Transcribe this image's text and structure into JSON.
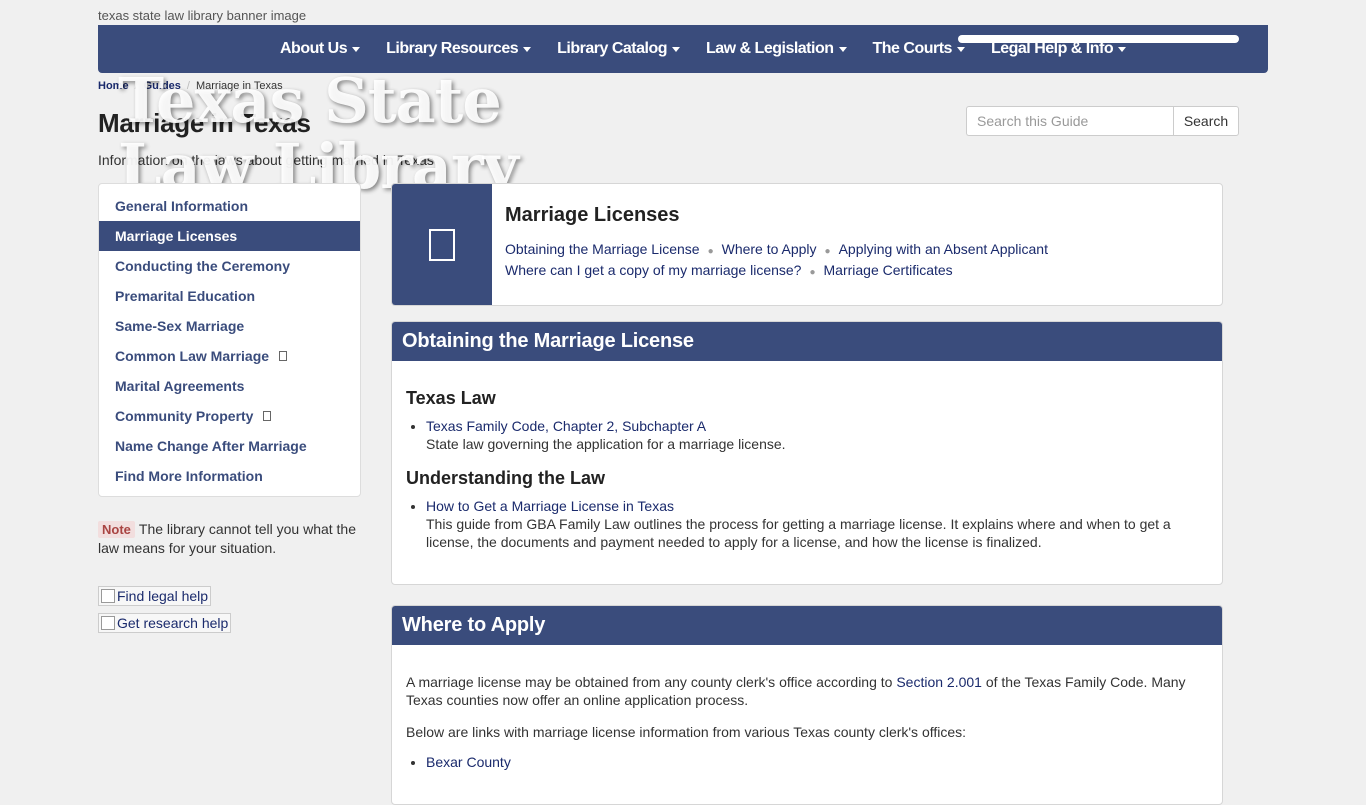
{
  "banner_alt": "texas state law library banner image",
  "logo_text_line1": "Texas State",
  "logo_text_line2": "Law Library",
  "nav": [
    "About Us",
    "Library Resources",
    "Library Catalog",
    "Law & Legislation",
    "The Courts",
    "Legal Help & Info"
  ],
  "breadcrumb": [
    "Home",
    "Guides",
    "Marriage in Texas"
  ],
  "page": {
    "title": "Marriage in Texas",
    "description": "Information on the laws about getting married in Texas"
  },
  "search": {
    "placeholder": "Search this Guide",
    "button": "Search"
  },
  "sidebar": [
    {
      "label": "General Information"
    },
    {
      "label": "Marriage Licenses",
      "active": true
    },
    {
      "label": "Conducting the Ceremony"
    },
    {
      "label": "Premarital Education"
    },
    {
      "label": "Same-Sex Marriage"
    },
    {
      "label": "Common Law Marriage",
      "dropdown": true
    },
    {
      "label": "Marital Agreements"
    },
    {
      "label": "Community Property",
      "dropdown": true
    },
    {
      "label": "Name Change After Marriage"
    },
    {
      "label": "Find More Information"
    }
  ],
  "note": {
    "badge": "Note",
    "text": "The library cannot tell you what the law means for your situation."
  },
  "help_links": {
    "legal": "Find legal help",
    "research": "Get research help"
  },
  "intro": {
    "title": "Marriage Licenses",
    "toc": [
      "Obtaining the Marriage License",
      "Where to Apply",
      "Applying with an Absent Applicant",
      "Where can I get a copy of my marriage license?",
      "Marriage Certificates"
    ]
  },
  "section1": {
    "title": "Obtaining the Marriage License",
    "h_law": "Texas Law",
    "law_link": "Texas Family Code, Chapter 2, Subchapter A",
    "law_desc": "State law governing the application for a marriage license.",
    "h_understanding": "Understanding the Law",
    "guide_link": "How to Get a Marriage License in Texas",
    "guide_desc": "This guide from GBA Family Law outlines the process for getting a marriage license. It explains where and when to get a license, the documents and payment needed to apply for a license, and how the license is finalized."
  },
  "section2": {
    "title": "Where to Apply",
    "p1_before": "A marriage license may be obtained from any county clerk's office according to ",
    "p1_link": "Section 2.001",
    "p1_after": " of the Texas Family Code.  Many Texas counties now offer an online application process.",
    "p2": "Below are links with marriage license information from various Texas county clerk's offices:",
    "county_first": "Bexar County"
  }
}
